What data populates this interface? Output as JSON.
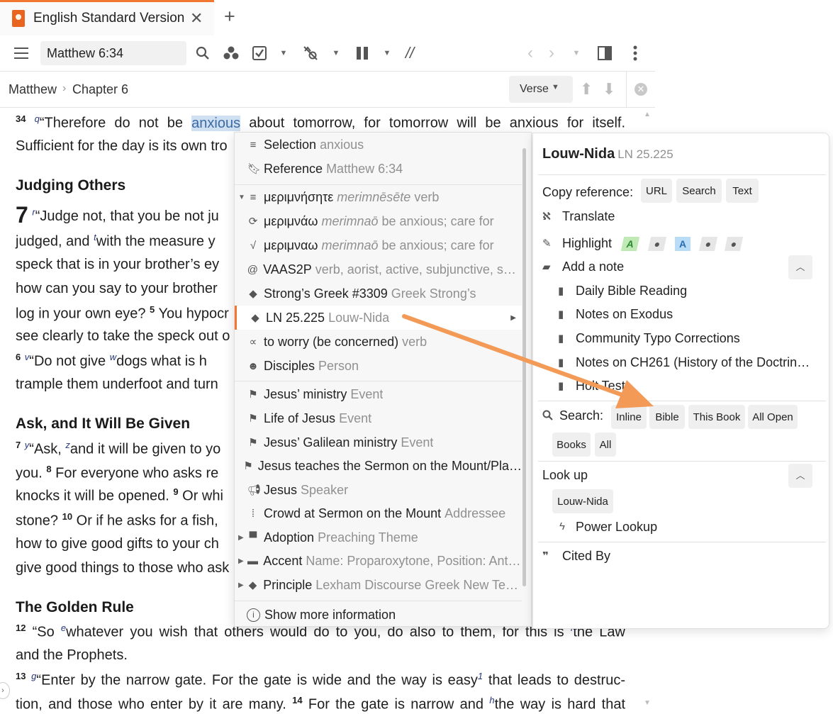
{
  "window": {
    "tab_title": "English Standard Version",
    "accent_color": "#f0772f"
  },
  "toolbar": {
    "reference_value": "Matthew 6:34",
    "icons": [
      "menu-icon",
      "search-icon",
      "people-icon",
      "checklist-icon",
      "inline-search-icon",
      "columns-icon",
      "parallel-icon",
      "back-icon",
      "forward-icon",
      "layout-icon",
      "more-icon"
    ]
  },
  "breadcrumb": {
    "book": "Matthew",
    "separator": "›",
    "chapter": "Chapter 6",
    "verse_mode": "Verse"
  },
  "bible": {
    "v34_num": "34",
    "v34_fn": "q",
    "v34_a": "“Therefore do not be ",
    "v34_hl": "anxious",
    "v34_b": " about tomorrow, for tomorrow will be anxious for itself.",
    "v34_line2": "Sufficient for the day is its own tro",
    "heading1": "Judging Others",
    "ch7_num": "7",
    "v1_fn": "r",
    "v1_text": "“Judge not, that you be not ju",
    "line_judged_a": "judged, and ",
    "line_judged_fn": "t",
    "line_judged_b": "with the measure y",
    "line_speck": "speck that is in your brother’s ey",
    "line_how": "how can you say to your brother",
    "line_log_a": "log in your own eye? ",
    "line_log_vn": "5",
    "line_log_b": " You hypocr",
    "line_see": "see clearly to take the speck out o",
    "v6_num": "6",
    "v6_fn1": "v",
    "v6_a": "“Do not give ",
    "v6_fn2": "w",
    "v6_b": "dogs what is h",
    "line_trample": "trample them underfoot and turn",
    "heading2": "Ask, and It Will Be Given",
    "v7_num": "7",
    "v7_fn1": "y",
    "v7_a": "“Ask, ",
    "v7_fn2": "z",
    "v7_b": "and it will be given to yo",
    "line_you_a": "you. ",
    "line_you_vn": "8",
    "line_you_b": " For everyone who asks re",
    "line_knocks_a": "knocks it will be opened. ",
    "line_knocks_vn": "9",
    "line_knocks_b": " Or whi",
    "line_stone_a": "stone? ",
    "line_stone_vn": "10",
    "line_stone_b": " Or if he asks for a fish,",
    "line_howgive": "how to give good gifts to your ch",
    "line_givegood": "give good things to those who ask",
    "heading3": "The Golden Rule",
    "v12_num": "12",
    "v12_a": " “So ",
    "v12_fn": "e",
    "v12_b": "whatever you wish that others would do to you, do also to them, for this is ",
    "v12_fn2": "f",
    "v12_c": "the Law",
    "line_prophets": "and the Prophets.",
    "v13_num": "13",
    "v13_fn": "g",
    "v13_a": "“Enter by the narrow gate. For the gate is wide and the way is easy",
    "v13_fn2": "1",
    "v13_b": " that leads to destruc-",
    "line_tion_a": "tion, and those who enter by it are many. ",
    "line_tion_vn": "14",
    "line_tion_b": " For the gate is narrow and ",
    "line_tion_fn": "h",
    "line_tion_c": "the way is hard that"
  },
  "context_menu": {
    "items": [
      {
        "icon": "lines-icon",
        "label": "Selection",
        "sub": "anxious"
      },
      {
        "icon": "bookmark-icon",
        "label": "Reference",
        "sub": "Matthew 6:34"
      },
      {
        "icon": "lines-icon",
        "label": "μεριμνήσητε",
        "sub_it": "merimnēsēte",
        "sub": "verb"
      },
      {
        "icon": "lemma-icon",
        "label": "μεριμνάω",
        "sub_it": "merimnaō",
        "sub": "be anxious; care for"
      },
      {
        "icon": "root-icon",
        "label": "μεριμναω",
        "sub_it": "merimnaō",
        "sub": "be anxious; care for"
      },
      {
        "icon": "at-icon",
        "label": "VAAS2P",
        "sub": "verb, aorist, active, subjunctive, sec…"
      },
      {
        "icon": "diamond-icon",
        "label": "Strong’s Greek #3309",
        "sub": "Greek Strong’s"
      },
      {
        "icon": "diamond-icon",
        "label": "LN 25.225",
        "sub": "Louw-Nida"
      },
      {
        "icon": "sense-icon",
        "label": "to worry (be concerned)",
        "sub": "verb"
      },
      {
        "icon": "person-icon",
        "label": "Disciples",
        "sub": "Person"
      },
      {
        "icon": "flag-icon",
        "label": "Jesus’ ministry",
        "sub": "Event"
      },
      {
        "icon": "flag-icon",
        "label": "Life of Jesus",
        "sub": "Event"
      },
      {
        "icon": "flag-icon",
        "label": "Jesus’ Galilean ministry",
        "sub": "Event"
      },
      {
        "icon": "flag-icon",
        "label": "Jesus teaches the Sermon on the Mount/Pla…",
        "sub": ""
      },
      {
        "icon": "megaphone-icon",
        "label": "Jesus",
        "sub": "Speaker"
      },
      {
        "icon": "listener-icon",
        "label": "Crowd at Sermon on the Mount",
        "sub": "Addressee"
      },
      {
        "icon": "pulpit-icon",
        "label": "Adoption",
        "sub": "Preaching Theme"
      },
      {
        "icon": "tag-icon",
        "label": "Accent",
        "sub": "Name: Proparoxytone, Position: Ante…"
      },
      {
        "icon": "diamond-icon",
        "label": "Principle",
        "sub": "Lexham Discourse Greek New Test…"
      }
    ],
    "show_more": "Show more information"
  },
  "panel": {
    "title": "Louw-Nida",
    "title_sub": "LN 25.225",
    "copy_reference_label": "Copy reference:",
    "copy_buttons": [
      "URL",
      "Search",
      "Text"
    ],
    "translate_label": "Translate",
    "highlight_label": "Highlight",
    "highlight_swatch_a": "A",
    "add_note_label": "Add a note",
    "notes": [
      "Daily Bible Reading",
      "Notes on Exodus",
      "Community Typo Corrections",
      "Notes on CH261 (History of the Doctrin…",
      "Holt Test"
    ],
    "search_label": "Search:",
    "search_buttons": [
      "Inline",
      "Bible",
      "This Book",
      "All Open",
      "Books",
      "All"
    ],
    "lookup_label": "Look up",
    "lookup_chip": "Louw-Nida",
    "power_lookup_label": "Power Lookup",
    "cited_by_label": "Cited By"
  }
}
